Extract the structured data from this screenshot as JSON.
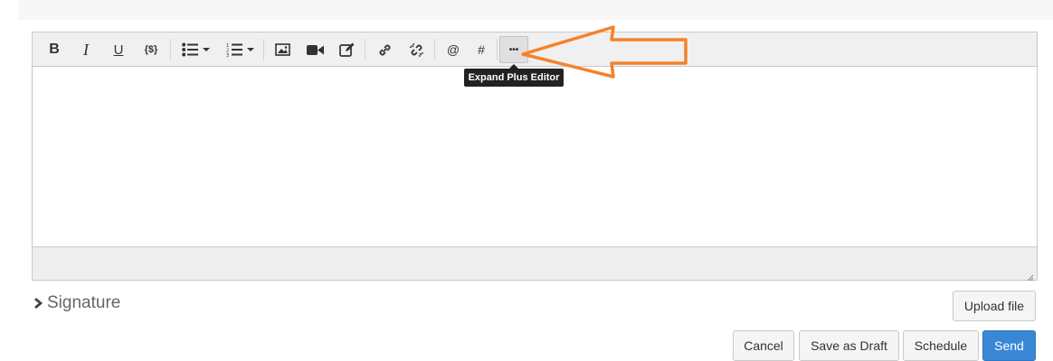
{
  "toolbar": {
    "bold": "B",
    "italic": "I",
    "underline": "U",
    "variable": "{$}",
    "mention": "@",
    "hashtag": "#",
    "more": "•••",
    "icons": [
      "bulleted-list-icon",
      "numbered-list-icon",
      "image-icon",
      "video-icon",
      "edit-icon",
      "link-icon",
      "unlink-icon"
    ]
  },
  "tooltip": {
    "label": "Expand Plus Editor"
  },
  "annotation": {
    "arrow_color": "#f5822a"
  },
  "signature": {
    "label": "Signature"
  },
  "buttons": {
    "upload": "Upload file",
    "cancel": "Cancel",
    "save_draft": "Save as Draft",
    "schedule": "Schedule",
    "send": "Send"
  },
  "colors": {
    "primary": "#3a87d6",
    "toolbar_bg": "#f0f0f0"
  }
}
